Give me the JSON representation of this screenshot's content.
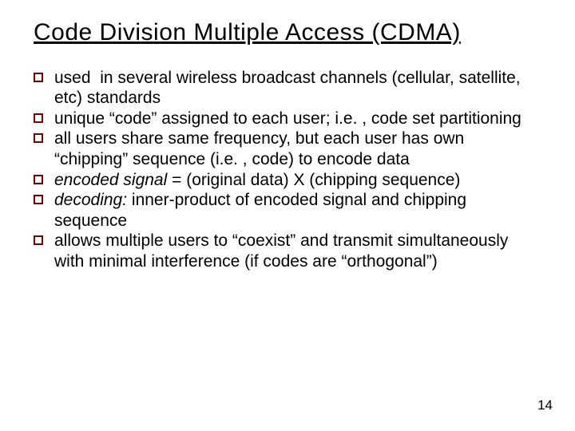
{
  "slide": {
    "title": "Code Division Multiple Access (CDMA)",
    "bullets": [
      {
        "pre": "used  in several wireless broadcast channels (cellular, satellite, etc) standards",
        "em": "",
        "post": ""
      },
      {
        "pre": "unique “code” assigned to each user; i.e. , code set partitioning",
        "em": "",
        "post": ""
      },
      {
        "pre": "all users share same frequency, but each user has own “chipping” sequence (i.e. , code) to encode data",
        "em": "",
        "post": ""
      },
      {
        "pre": "",
        "em": "encoded signal",
        "post": " = (original data) X (chipping sequence)"
      },
      {
        "pre": "",
        "em": "decoding:",
        "post": " inner-product of encoded signal and chipping sequence"
      },
      {
        "pre": "allows multiple users to “coexist” and transmit simultaneously with minimal interference (if codes are “orthogonal”)",
        "em": "",
        "post": ""
      }
    ],
    "page_number": "14"
  }
}
